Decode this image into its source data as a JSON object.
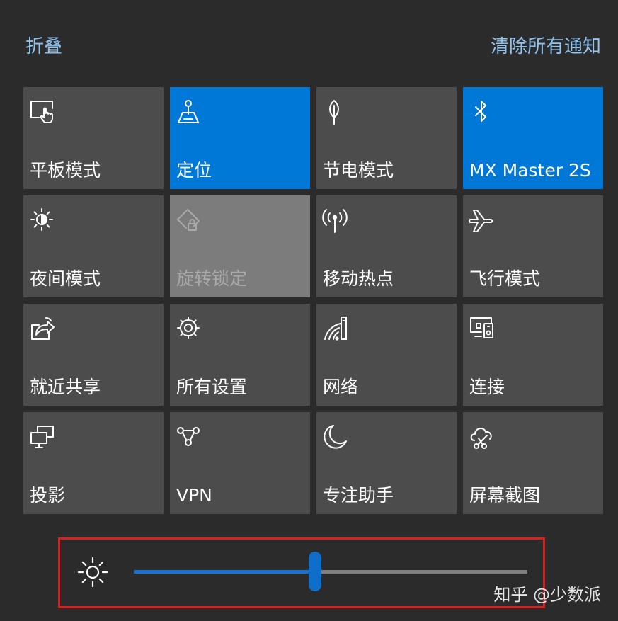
{
  "header": {
    "collapse_label": "折叠",
    "clear_all_label": "清除所有通知"
  },
  "tiles": [
    {
      "label": "平板模式",
      "icon": "tablet-mode-icon",
      "state": "off"
    },
    {
      "label": "定位",
      "icon": "location-icon",
      "state": "on"
    },
    {
      "label": "节电模式",
      "icon": "battery-saver-icon",
      "state": "off"
    },
    {
      "label": "MX Master 2S",
      "icon": "bluetooth-icon",
      "state": "on"
    },
    {
      "label": "夜间模式",
      "icon": "night-light-icon",
      "state": "off"
    },
    {
      "label": "旋转锁定",
      "icon": "rotation-lock-icon",
      "state": "disabled"
    },
    {
      "label": "移动热点",
      "icon": "mobile-hotspot-icon",
      "state": "off"
    },
    {
      "label": "飞行模式",
      "icon": "airplane-icon",
      "state": "off"
    },
    {
      "label": "就近共享",
      "icon": "nearby-share-icon",
      "state": "off"
    },
    {
      "label": "所有设置",
      "icon": "settings-gear-icon",
      "state": "off"
    },
    {
      "label": "网络",
      "icon": "network-icon",
      "state": "off"
    },
    {
      "label": "连接",
      "icon": "connect-icon",
      "state": "off"
    },
    {
      "label": "投影",
      "icon": "project-icon",
      "state": "off"
    },
    {
      "label": "VPN",
      "icon": "vpn-icon",
      "state": "off"
    },
    {
      "label": "专注助手",
      "icon": "focus-assist-moon-icon",
      "state": "off"
    },
    {
      "label": "屏幕截图",
      "icon": "screen-snip-icon",
      "state": "off"
    }
  ],
  "brightness": {
    "icon": "brightness-sun-icon",
    "level_percent": 46
  },
  "colors": {
    "background": "#2b2b2b",
    "tile_off": "#4c4c4c",
    "tile_on": "#0078d7",
    "tile_disabled": "#7c7c7c",
    "link": "#8fc3f0",
    "highlight_border": "#d7201f"
  },
  "watermark": "知乎 @少数派"
}
